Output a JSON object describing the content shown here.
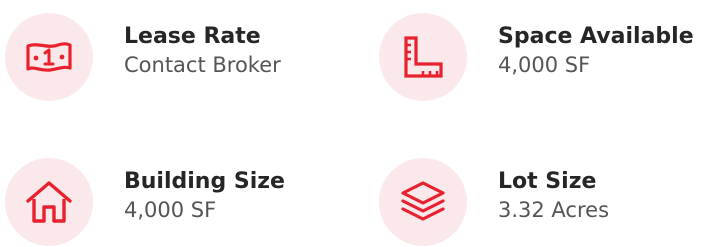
{
  "accent_color": "#e8212e",
  "icon_background_color": "#fbe8ea",
  "stats": [
    {
      "icon": "money-bill-icon",
      "label": "Lease Rate",
      "value": "Contact Broker"
    },
    {
      "icon": "ruler-square-icon",
      "label": "Space Available",
      "value": "4,000 SF"
    },
    {
      "icon": "house-icon",
      "label": "Building Size",
      "value": "4,000 SF"
    },
    {
      "icon": "layers-icon",
      "label": "Lot Size",
      "value": "3.32 Acres"
    }
  ]
}
